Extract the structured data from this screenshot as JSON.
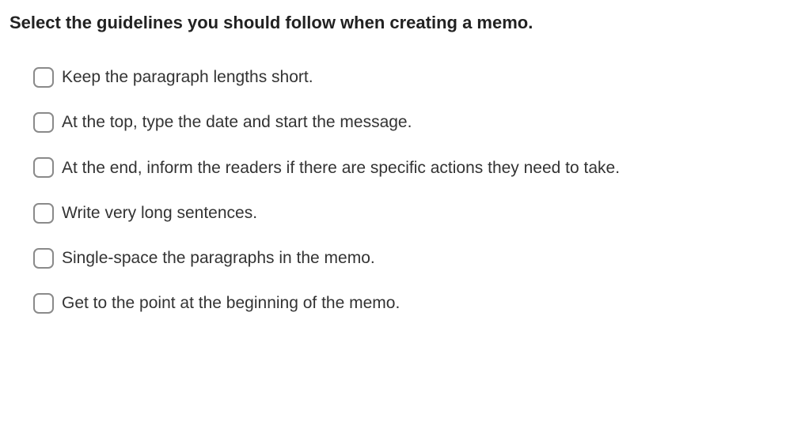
{
  "question": {
    "title": "Select the guidelines you should follow when creating a memo."
  },
  "options": [
    {
      "label": "Keep the paragraph lengths short."
    },
    {
      "label": "At the top, type the date and start the message."
    },
    {
      "label": "At the end, inform the readers if there are specific actions they need to take."
    },
    {
      "label": "Write very long sentences."
    },
    {
      "label": "Single-space the paragraphs in the memo."
    },
    {
      "label": "Get to the point at the beginning of the memo."
    }
  ]
}
